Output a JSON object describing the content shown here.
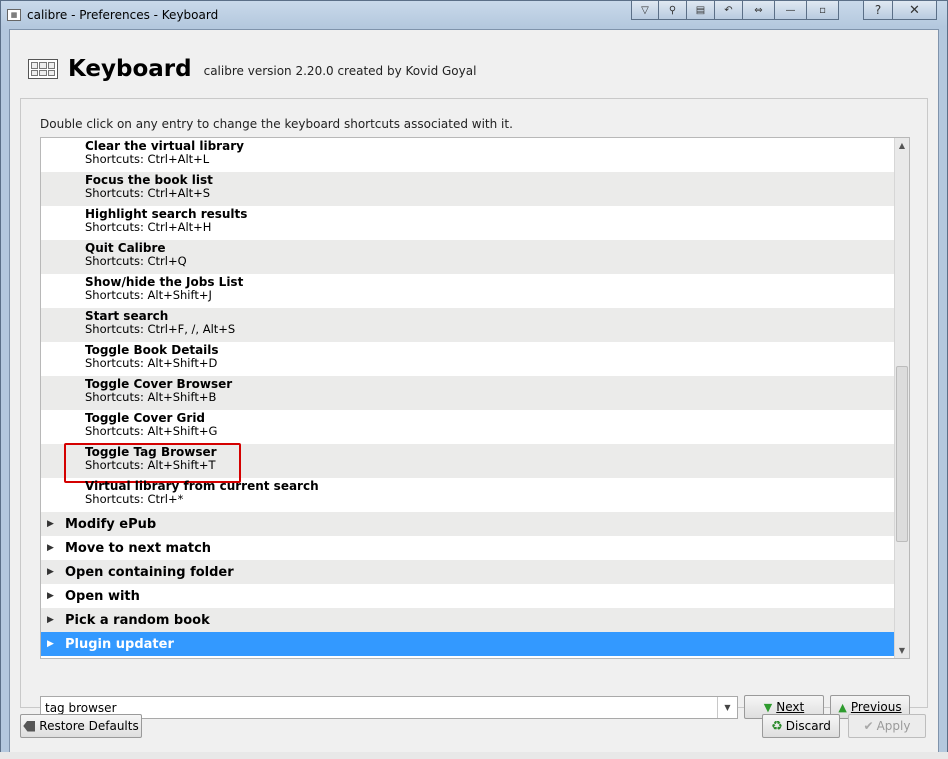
{
  "window": {
    "title": "calibre - Preferences - Keyboard",
    "controls": [
      "▽",
      "⚲",
      "▤",
      "↶",
      "⇔",
      "—",
      "▫"
    ],
    "help": "?",
    "close": "✕"
  },
  "header": {
    "title": "Keyboard",
    "version": "calibre version 2.20.0 created by Kovid Goyal"
  },
  "instruction": "Double click on any entry to change the keyboard shortcuts associated with it.",
  "shortcuts": [
    {
      "name": "Clear the virtual library",
      "shortcut": "Shortcuts: Ctrl+Alt+L"
    },
    {
      "name": "Focus the book list",
      "shortcut": "Shortcuts: Ctrl+Alt+S"
    },
    {
      "name": "Highlight search results",
      "shortcut": "Shortcuts: Ctrl+Alt+H"
    },
    {
      "name": "Quit Calibre",
      "shortcut": "Shortcuts: Ctrl+Q"
    },
    {
      "name": "Show/hide the Jobs List",
      "shortcut": "Shortcuts: Alt+Shift+J"
    },
    {
      "name": "Start search",
      "shortcut": "Shortcuts: Ctrl+F, /, Alt+S"
    },
    {
      "name": "Toggle Book Details",
      "shortcut": "Shortcuts: Alt+Shift+D"
    },
    {
      "name": "Toggle Cover Browser",
      "shortcut": "Shortcuts: Alt+Shift+B"
    },
    {
      "name": "Toggle Cover Grid",
      "shortcut": "Shortcuts: Alt+Shift+G"
    },
    {
      "name": "Toggle Tag Browser",
      "shortcut": "Shortcuts: Alt+Shift+T"
    },
    {
      "name": "Virtual library from current search",
      "shortcut": "Shortcuts: Ctrl+*"
    }
  ],
  "categories": [
    {
      "label": "Modify ePub"
    },
    {
      "label": "Move to next match"
    },
    {
      "label": "Open containing folder"
    },
    {
      "label": "Open with"
    },
    {
      "label": "Pick a random book"
    },
    {
      "label": "Plugin updater"
    }
  ],
  "search": {
    "value": "tag browser"
  },
  "buttons": {
    "next": "Next",
    "previous": "Previous",
    "restore_defaults": "Restore Defaults",
    "discard": "Discard",
    "apply": "Apply"
  }
}
